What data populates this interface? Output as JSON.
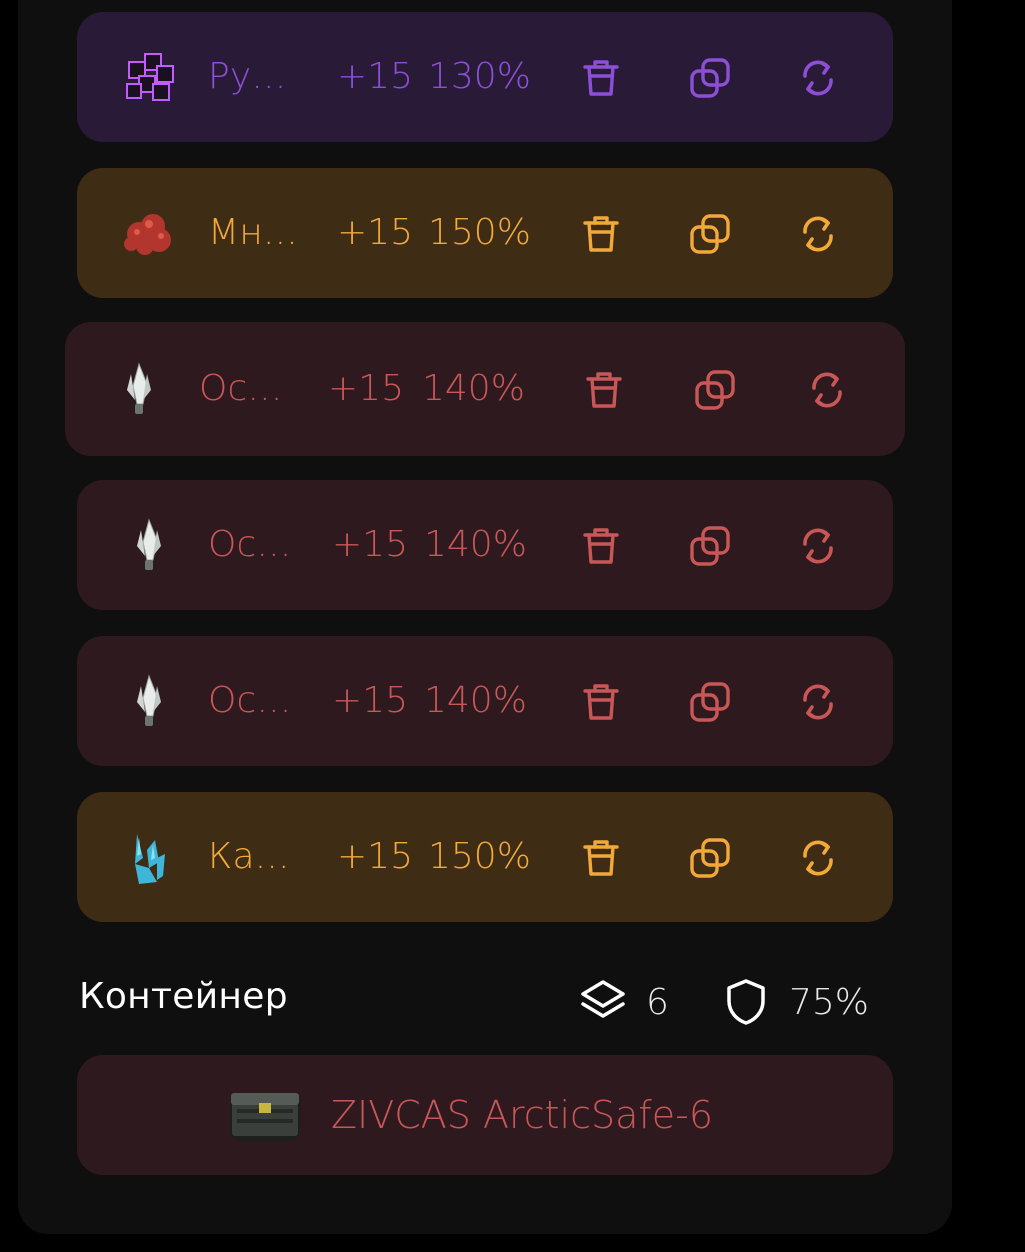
{
  "items": [
    {
      "name": "Ру...",
      "level": "+15",
      "percent": "130%",
      "color": "#8c4fd6",
      "bg": "#291b38",
      "icon": "cube-cluster-icon"
    },
    {
      "name": "Мн...",
      "level": "+15",
      "percent": "150%",
      "color": "#f2a93a",
      "bg": "#3f2c14",
      "icon": "red-ore-icon"
    },
    {
      "name": "Ос...",
      "level": "+15",
      "percent": "140%",
      "color": "#c95757",
      "bg": "#2e1a1e",
      "icon": "crystal-shard-icon"
    },
    {
      "name": "Ос...",
      "level": "+15",
      "percent": "140%",
      "color": "#c95757",
      "bg": "#2e1a1e",
      "icon": "crystal-shard-icon"
    },
    {
      "name": "Ос...",
      "level": "+15",
      "percent": "140%",
      "color": "#c95757",
      "bg": "#2e1a1e",
      "icon": "crystal-shard-icon"
    },
    {
      "name": "Ка...",
      "level": "+15",
      "percent": "150%",
      "color": "#f2a93a",
      "bg": "#3f2c14",
      "icon": "blue-crystal-icon"
    }
  ],
  "footer": {
    "label": "Контейнер",
    "layers_count": "6",
    "shield_percent": "75%"
  },
  "container": {
    "name": "ZIVCAS ArcticSafe-6",
    "color": "#c95757",
    "bg": "#2e1a1e",
    "icon": "safe-box-icon"
  }
}
